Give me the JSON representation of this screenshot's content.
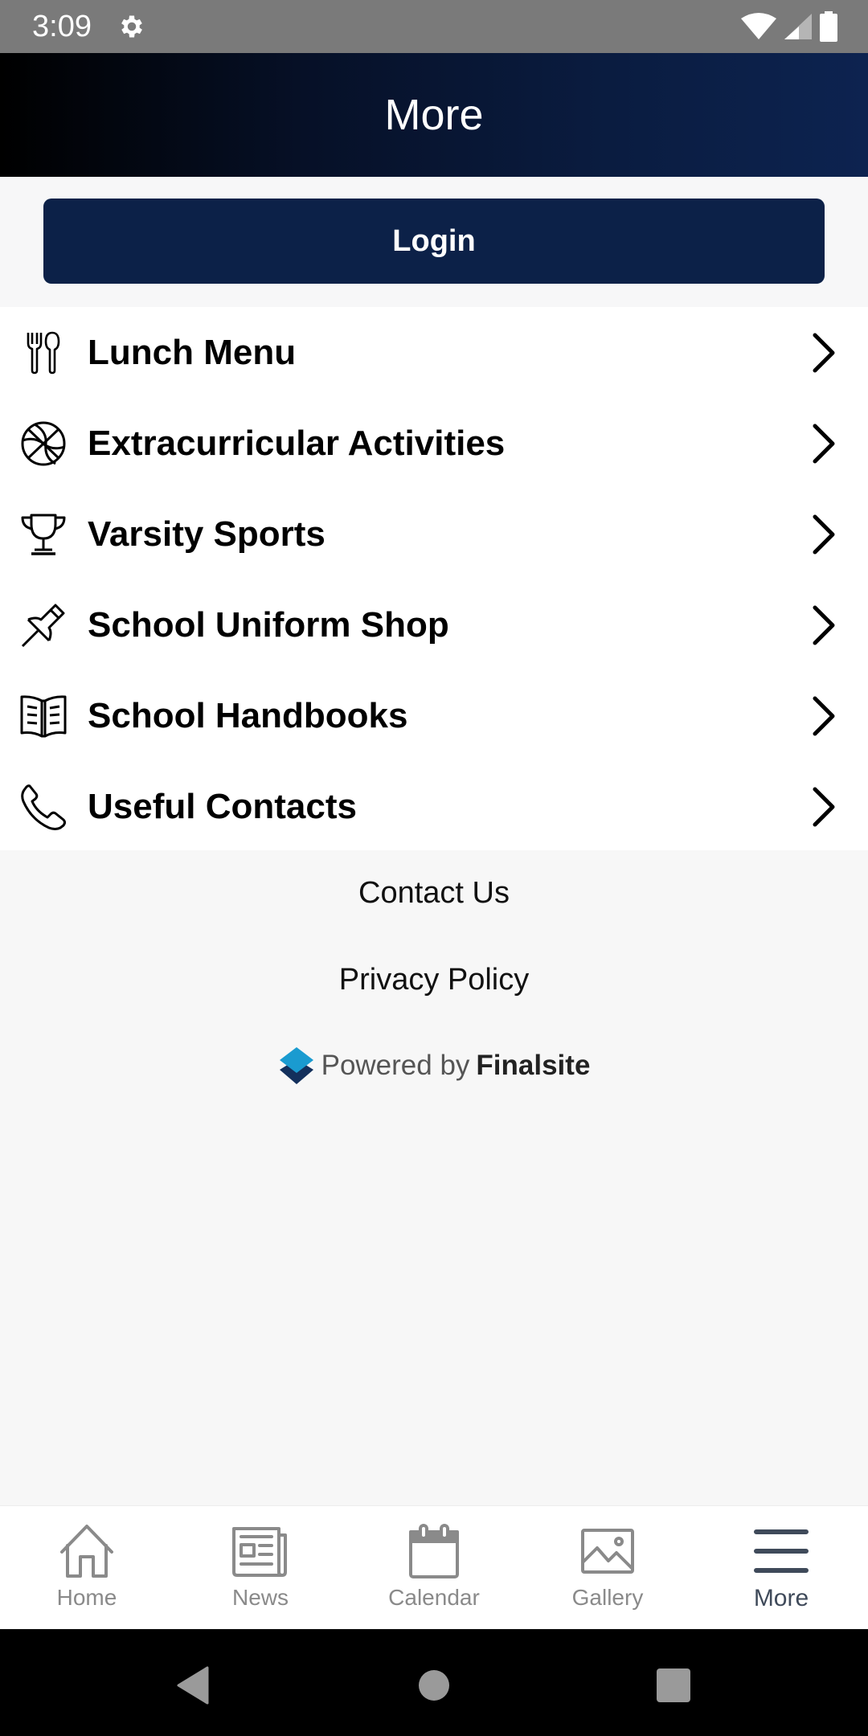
{
  "status_bar": {
    "time": "3:09",
    "icons": [
      "settings-gear-icon",
      "wifi-icon",
      "cellular-signal-icon",
      "battery-icon"
    ]
  },
  "header": {
    "title": "More"
  },
  "login": {
    "label": "Login"
  },
  "menu": {
    "items": [
      {
        "label": "Lunch Menu",
        "icon": "fork-spoon-icon"
      },
      {
        "label": "Extracurricular Activities",
        "icon": "basketball-icon"
      },
      {
        "label": "Varsity Sports",
        "icon": "trophy-icon"
      },
      {
        "label": "School Uniform Shop",
        "icon": "pushpin-icon"
      },
      {
        "label": "School Handbooks",
        "icon": "open-book-icon"
      },
      {
        "label": "Useful Contacts",
        "icon": "phone-icon"
      }
    ]
  },
  "footer": {
    "contact_us": "Contact Us",
    "privacy_policy": "Privacy Policy",
    "powered_by": "Powered by",
    "brand": "Finalsite"
  },
  "bottom_nav": {
    "items": [
      {
        "label": "Home",
        "icon": "home-icon",
        "active": false
      },
      {
        "label": "News",
        "icon": "newspaper-icon",
        "active": false
      },
      {
        "label": "Calendar",
        "icon": "calendar-icon",
        "active": false
      },
      {
        "label": "Gallery",
        "icon": "image-icon",
        "active": false
      },
      {
        "label": "More",
        "icon": "hamburger-menu-icon",
        "active": true
      }
    ]
  },
  "colors": {
    "brand_navy": "#0c2148",
    "nav_inactive": "#8a8a8a",
    "nav_active": "#3f4a5a",
    "finalsite_blue": "#1a9bd0",
    "finalsite_navy": "#13305c"
  }
}
